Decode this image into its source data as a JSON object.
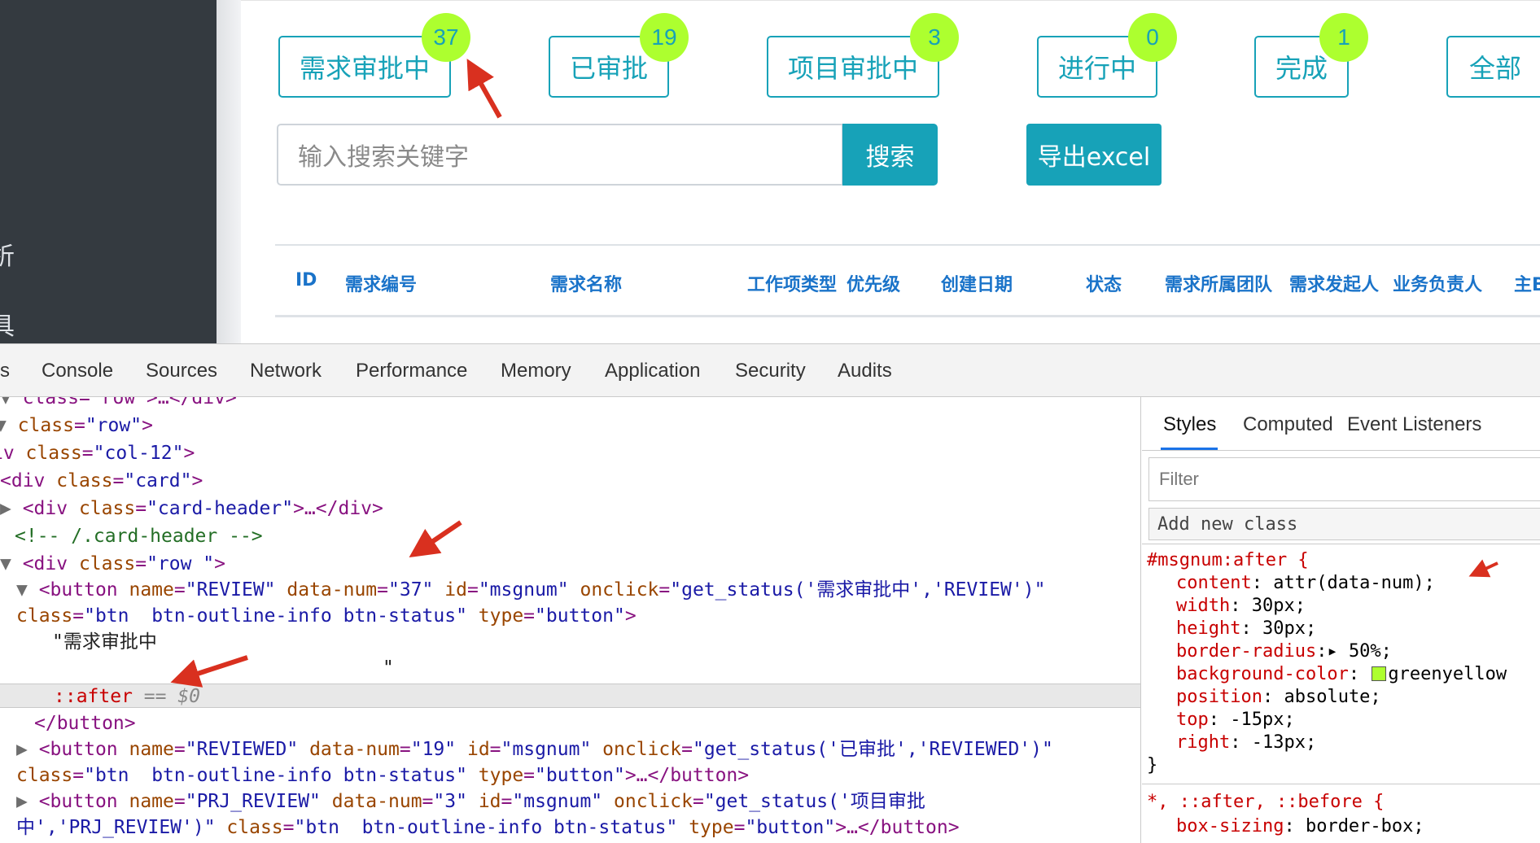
{
  "sidebar": {
    "fragments": [
      "析",
      "具"
    ]
  },
  "status_buttons": [
    {
      "label": "需求审批中",
      "count": "37"
    },
    {
      "label": "已审批",
      "count": "19"
    },
    {
      "label": "项目审批中",
      "count": "3"
    },
    {
      "label": "进行中",
      "count": "0"
    },
    {
      "label": "完成",
      "count": "1"
    },
    {
      "label": "全部",
      "count": ""
    }
  ],
  "search": {
    "placeholder": "输入搜索关键字",
    "button_label": "搜索"
  },
  "export": {
    "label": "导出excel"
  },
  "table": {
    "headers": [
      "ID",
      "需求编号",
      "需求名称",
      "工作项类型",
      "优先级",
      "创建日期",
      "状态",
      "需求所属团队",
      "需求发起人",
      "业务负责人",
      "主B"
    ]
  },
  "devtools": {
    "tabs": [
      "s",
      "Console",
      "Sources",
      "Network",
      "Performance",
      "Memory",
      "Application",
      "Security",
      "Audits"
    ],
    "styles_tabs": [
      "Styles",
      "Computed",
      "Event Listeners"
    ],
    "filter_placeholder": "Filter",
    "add_class_placeholder": "Add new class",
    "rule1": {
      "selector": "#msgnum:after {",
      "decls": [
        {
          "prop": "content",
          "value": "attr(data-num);"
        },
        {
          "prop": "width",
          "value": "30px;"
        },
        {
          "prop": "height",
          "value": "30px;"
        },
        {
          "prop": "border-radius",
          "value": "50%;"
        },
        {
          "prop": "background-color",
          "value": "greenyellow"
        },
        {
          "prop": "position",
          "value": "absolute;"
        },
        {
          "prop": "top",
          "value": "-15px;"
        },
        {
          "prop": "right",
          "value": "-13px;"
        }
      ],
      "close": "}"
    },
    "rule2": {
      "selector": "*, ::after, ::before {",
      "prop": "box-sizing",
      "value": "border-box;"
    },
    "dom": {
      "l0": "class=\"row\">…</div>",
      "l1_attr": "class",
      "l1_val": "\"row\"",
      "l2_attr": "class",
      "l2_val": "\"col-12\"",
      "l3_attr": "class",
      "l3_val": "\"card\"",
      "l4_attr": "class",
      "l4_val": "\"card-header\"",
      "comment": "<!-- /.card-header -->",
      "l6_attr": "class",
      "l6_val": "\"row \"",
      "btn1": {
        "name": "\"REVIEW\"",
        "num": "\"37\"",
        "id": "\"msgnum\"",
        "onclick": "\"get_status('需求审批中','REVIEW')\"",
        "class": "\"btn  btn-outline-info btn-status\"",
        "type": "\"button\""
      },
      "btn1_text": "\"需求审批中",
      "btn1_text_end": "\"",
      "after": "::after",
      "after_eq": "== $0",
      "close_button": "</button>",
      "btn2": {
        "name": "\"REVIEWED\"",
        "num": "\"19\"",
        "id": "\"msgnum\"",
        "onclick": "\"get_status('已审批','REVIEWED')\"",
        "class": "\"btn  btn-outline-info btn-status\"",
        "type": "\"button\""
      },
      "btn3": {
        "name": "\"PRJ_REVIEW\"",
        "num": "\"3\"",
        "id": "\"msgnum\"",
        "onclick_a": "\"get_status('项目审批",
        "onclick_b": "中','PRJ_REVIEW')\"",
        "class": "\"btn  btn-outline-info btn-status\"",
        "type": "\"button\""
      }
    }
  },
  "colors": {
    "accent": "#17a2b8",
    "badge": "#adff2f",
    "sidebar": "#343a40",
    "arrow": "#d9301f"
  }
}
